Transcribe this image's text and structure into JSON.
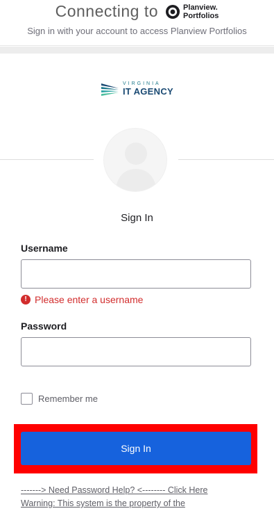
{
  "header": {
    "connecting_text": "Connecting to",
    "brand_line1": "Planview.",
    "brand_line2": "Portfolios",
    "subtitle": "Sign in with your account to access Planview Portfolios"
  },
  "org": {
    "line1": "VIRGINIA",
    "line2": "IT AGENCY"
  },
  "form": {
    "title": "Sign In",
    "username_label": "Username",
    "username_value": "",
    "username_error": "Please enter a username",
    "error_icon": "!",
    "password_label": "Password",
    "password_value": "",
    "remember_label": "Remember me",
    "remember_checked": false,
    "submit_label": "Sign In"
  },
  "footer": {
    "help_link": "-------> Need Password Help? <-------- Click Here",
    "warning_link": "Warning: This system is the property of the"
  },
  "colors": {
    "primary_button": "#1662dd",
    "error": "#d22d2d",
    "highlight": "#ff0000"
  }
}
